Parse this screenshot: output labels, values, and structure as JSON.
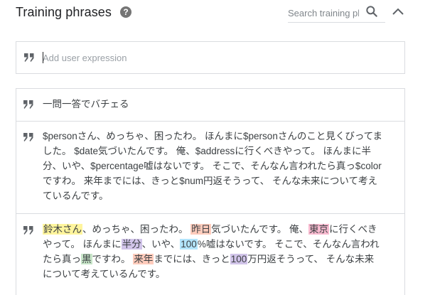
{
  "header": {
    "title": "Training phrases",
    "help_glyph": "?",
    "search": {
      "placeholder": "Search training phrases"
    }
  },
  "add_box": {
    "placeholder": "Add user expression"
  },
  "colors": {
    "yellow": "#fff59d",
    "orange": "#ffccbc",
    "pink": "#f8bbd0",
    "purple": "#d1c4e9",
    "blue": "#b3e5fc",
    "green": "#c8e6c9"
  },
  "phrases": [
    {
      "text": "一問一答でバチェる"
    },
    {
      "text": "$personさん、めっちゃ、困ったわ。 ほんまに$personさんのこと見くびってました。 $date気づいたんです。 俺、$addressに行くべきやって。 ほんまに半分、いや、$percentage嘘はないです。 そこで、そんなん言われたら真っ$colorですわ。 来年までには、きっと$num円返そうって、 そんな未来について考えているんです。"
    },
    {
      "segments": [
        {
          "text": "鈴木さん",
          "color": "yellow"
        },
        {
          "text": "、めっちゃ、困ったわ。 "
        },
        {
          "text": "昨日",
          "color": "orange"
        },
        {
          "text": "気づいたんです。 俺、"
        },
        {
          "text": "東京",
          "color": "pink"
        },
        {
          "text": "に行くべきやって。 ほんまに"
        },
        {
          "text": "半分",
          "color": "purple"
        },
        {
          "text": "、いや、"
        },
        {
          "text": "100",
          "color": "blue"
        },
        {
          "text": "%嘘はないです。 そこで、そんなん言われたら真っ"
        },
        {
          "text": "黒",
          "color": "green"
        },
        {
          "text": "ですわ。 "
        },
        {
          "text": "来年",
          "color": "orange"
        },
        {
          "text": "までには、きっと"
        },
        {
          "text": "100",
          "color": "purple"
        },
        {
          "text": "万円返そうって、 そんな未来について考えているんです。"
        }
      ]
    }
  ]
}
